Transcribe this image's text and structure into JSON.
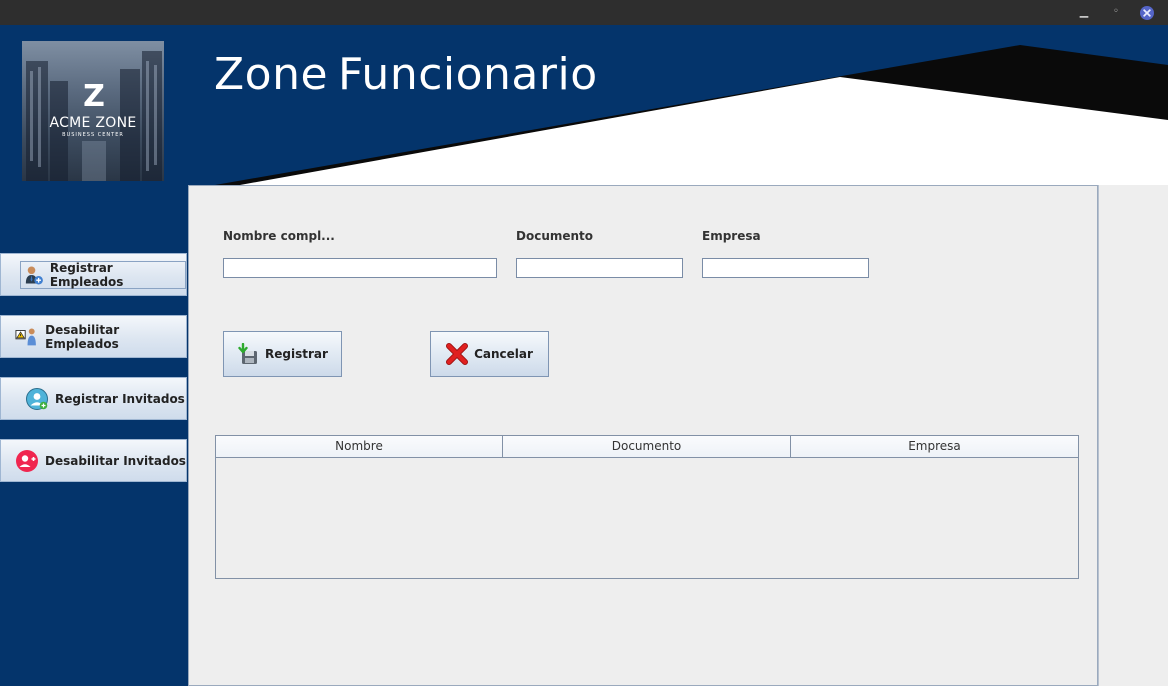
{
  "window": {
    "minimize_icon": "minimize-icon",
    "maximize_icon": "maximize-icon",
    "close_icon": "close-icon",
    "close_color": "#5565c8"
  },
  "header": {
    "logo": {
      "brand": "ACME ZONE",
      "tagline": "BUSINESS CENTER"
    },
    "title_part1": "Zone",
    "title_part2": "Funcionario"
  },
  "sidebar": {
    "items": [
      {
        "label": "Registrar Empleados",
        "icon": "add-employee-icon"
      },
      {
        "label": "Desabilitar Empleados",
        "icon": "disable-employee-icon"
      },
      {
        "label": "Registrar Invitados",
        "icon": "register-guest-icon"
      },
      {
        "label": "Desabilitar Invitados",
        "icon": "disable-guest-icon"
      }
    ]
  },
  "form": {
    "fields": [
      {
        "label": "Nombre compl...",
        "value": ""
      },
      {
        "label": "Documento",
        "value": ""
      },
      {
        "label": "Empresa",
        "value": ""
      }
    ],
    "register_label": "Registrar",
    "cancel_label": "Cancelar"
  },
  "table": {
    "columns": [
      "Nombre",
      "Documento",
      "Empresa"
    ],
    "rows": []
  },
  "colors": {
    "navy": "#04346b",
    "panel": "#eeeeee",
    "cancel_red": "#e02020",
    "download_green": "#2eaa2e"
  }
}
